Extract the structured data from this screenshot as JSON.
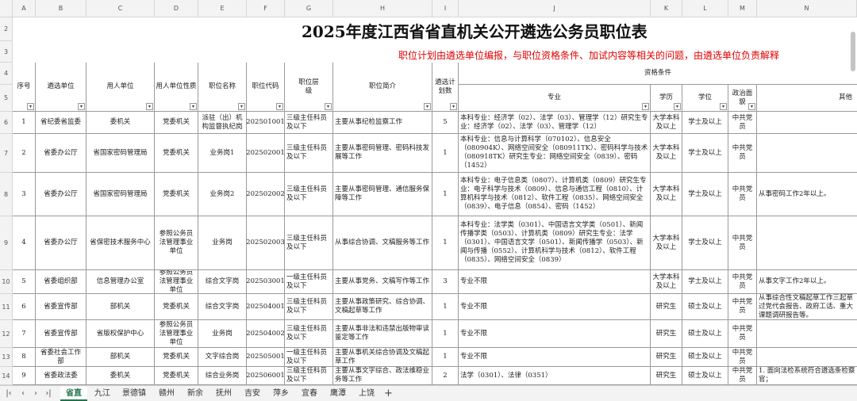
{
  "columns": [
    "A",
    "B",
    "C",
    "D",
    "E",
    "F",
    "G",
    "H",
    "I",
    "J",
    "K",
    "L",
    "M",
    "N"
  ],
  "row_numbers": [
    "2",
    "3",
    "4",
    "5",
    "6",
    "7",
    "8",
    "9",
    "10",
    "11",
    "12",
    "13",
    "14"
  ],
  "title": "2025年度江西省省直机关公开遴选公务员职位表",
  "subtitle": "职位计划由遴选单位编报，与职位资格条件、加试内容等相关的问题，由遴选单位负责解释",
  "headers": {
    "seq": "序号",
    "unit": "遴选单位",
    "employer": "用人单位",
    "nature": "用人单位性质",
    "position": "职位名称",
    "code": "职位代码",
    "level": "职位层级",
    "intro": "职位简介",
    "plan": "遴选计划数",
    "qualifications": "资格条件",
    "major": "专业",
    "education": "学历",
    "degree": "学位",
    "politics": "政治面貌",
    "other": "其他"
  },
  "rows": [
    {
      "seq": "1",
      "unit": "省纪委省监委",
      "employer": "委机关",
      "nature": "党委机关",
      "position": "派驻（出）机构监督执纪岗",
      "code": "202501001",
      "level": "三级主任科员及以下",
      "intro": "主要从事纪检监察工作",
      "plan": "5",
      "major": "本科专业：经济学（02）、法学（03）、管理学（12）研究生专业：经济学（02）、法学（03）、管理学（12）",
      "education": "大学本科及以上",
      "degree": "学士及以上",
      "politics": "中共党员",
      "other": ""
    },
    {
      "seq": "2",
      "unit": "省委办公厅",
      "employer": "省国家密码管理局",
      "nature": "党委机关",
      "position": "业务岗1",
      "code": "202502001",
      "level": "三级主任科员及以下",
      "intro": "主要从事密码管理、密码科技发展等工作",
      "plan": "1",
      "major": "本科专业：信息与计算科学（070102）、信息安全（080904K）、网络空间安全（080911TK）、密码科学与技术（080918TK）研究生专业：网络空间安全（0839）、密码（1452）",
      "education": "大学本科及以上",
      "degree": "学士及以上",
      "politics": "中共党员",
      "other": ""
    },
    {
      "seq": "3",
      "unit": "省委办公厅",
      "employer": "省国家密码管理局",
      "nature": "党委机关",
      "position": "业务岗2",
      "code": "202502002",
      "level": "三级主任科员及以下",
      "intro": "主要从事密码管理、通信服务保障等工作",
      "plan": "1",
      "major": "本科专业：电子信息类（0807）、计算机类（0809）研究生专业：电子科学与技术（0809）、信息与通信工程（0810）、计算机科学与技术（0812）、软件工程（0835）、网络空间安全（0839）、电子信息（0854）、密码（1452）",
      "education": "大学本科及以上",
      "degree": "学士及以上",
      "politics": "中共党员",
      "other": "从事密码工作2年以上。"
    },
    {
      "seq": "4",
      "unit": "省委办公厅",
      "employer": "省保密技术服务中心",
      "nature": "参照公务员法管理事业单位",
      "position": "业务岗",
      "code": "202502003",
      "level": "三级主任科员及以下",
      "intro": "从事综合协调、文稿服务等工作",
      "plan": "1",
      "major": "本科专业：法学类（0301）、中国语言文学类（0501）、新闻传播学类（0503）、计算机类（0809）研究生专业：法学（0301）、中国语言文学（0501）、新闻传播学（0503）、新闻与传播（0552）、计算机科学与技术（0812）、软件工程（0835）、网络空间安全（0839）",
      "education": "大学本科及以上",
      "degree": "学士及以上",
      "politics": "中共党员",
      "other": ""
    },
    {
      "seq": "5",
      "unit": "省委组织部",
      "employer": "信息管理办公室",
      "nature": "参照公务员法管理事业单位",
      "position": "综合文字岗",
      "code": "202503001",
      "level": "一级主任科员及以下",
      "intro": "主要从事党务、文稿写作等工作",
      "plan": "3",
      "major": "专业不限",
      "education": "大学本科及以上",
      "degree": "学士及以上",
      "politics": "中共党员",
      "other": "从事文字工作2年以上。"
    },
    {
      "seq": "6",
      "unit": "省委宣传部",
      "employer": "部机关",
      "nature": "党委机关",
      "position": "综合文字岗",
      "code": "202504001",
      "level": "三级主任科员及以下",
      "intro": "主要从事政策研究、综合协调、文稿起草等工作",
      "plan": "1",
      "major": "专业不限",
      "education": "研究生",
      "degree": "硕士及以上",
      "politics": "中共党员",
      "other": "从事综合性文稿起草工作三起草过党代会报告、政府工话、重大课题调研报告等。"
    },
    {
      "seq": "7",
      "unit": "省委宣传部",
      "employer": "省版权保护中心",
      "nature": "参照公务员法管理事业单位",
      "position": "业务岗",
      "code": "202504002",
      "level": "三级主任科员及以下",
      "intro": "主要从事非法和违禁出版物审读鉴定等工作",
      "plan": "1",
      "major": "专业不限",
      "education": "研究生",
      "degree": "硕士及以上",
      "politics": "中共党员",
      "other": ""
    },
    {
      "seq": "8",
      "unit": "省委社会工作部",
      "employer": "部机关",
      "nature": "党委机关",
      "position": "文字综合岗",
      "code": "202505001",
      "level": "一级主任科员及以下",
      "intro": "主要从事机关综合协调及文稿起草工作",
      "plan": "1",
      "major": "专业不限",
      "education": "研究生",
      "degree": "硕士及以上",
      "politics": "中共党员",
      "other": ""
    },
    {
      "seq": "9",
      "unit": "省委政法委",
      "employer": "委机关",
      "nature": "党委机关",
      "position": "综合业务岗",
      "code": "202506001",
      "level": "三级主任科员及以下",
      "intro": "主要从事文字综合、政法维稳业务等工作",
      "plan": "2",
      "major": "法学（0301）、法律（0351）",
      "education": "研究生",
      "degree": "硕士及以上",
      "politics": "中共党员",
      "other": "1. 面向法检系统符合遴选条检察官；"
    }
  ],
  "tabs": [
    "省直",
    "九江",
    "景德镇",
    "赣州",
    "新余",
    "抚州",
    "吉安",
    "萍乡",
    "宜春",
    "鹰潭",
    "上饶"
  ],
  "active_tab": "省直",
  "nav": {
    "first": "|‹",
    "prev": "‹",
    "next": "›",
    "last": "›|",
    "add": "+"
  }
}
